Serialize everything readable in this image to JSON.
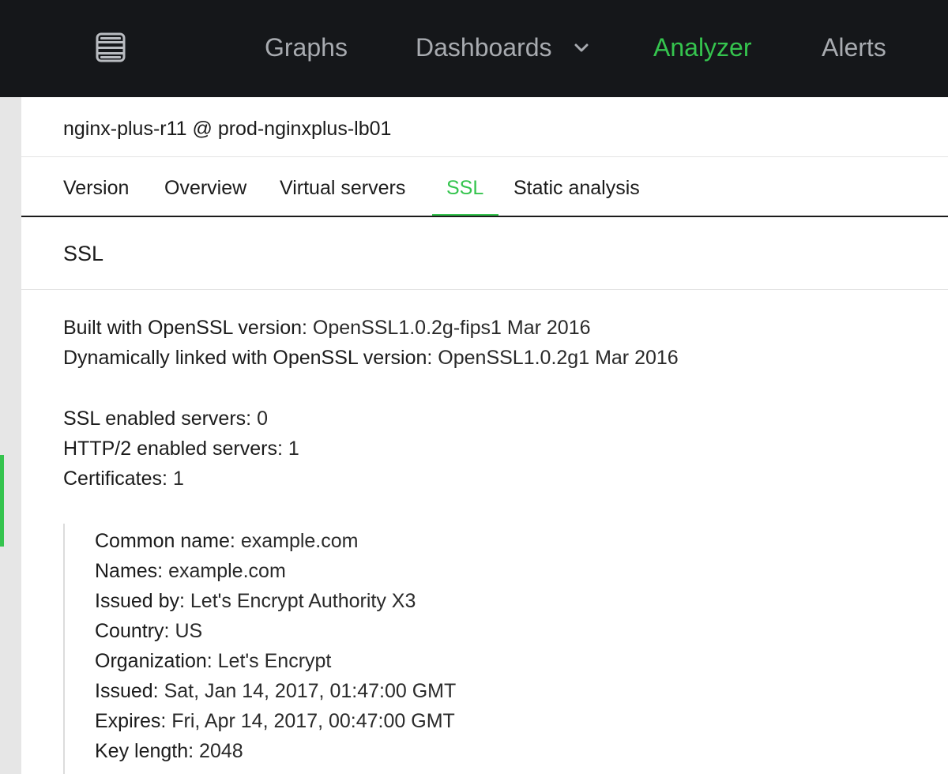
{
  "topnav": {
    "logo_icon": "server-stack-icon",
    "items": [
      {
        "label": "Graphs"
      },
      {
        "label": "Dashboards"
      },
      {
        "label": "Analyzer"
      },
      {
        "label": "Alerts"
      }
    ],
    "accent": "#35c44e"
  },
  "breadcrumb": "nginx-plus-r11 @ prod-nginxplus-lb01",
  "tabs": [
    {
      "label": "Version"
    },
    {
      "label": "Overview"
    },
    {
      "label": "Virtual servers"
    },
    {
      "label": "SSL"
    },
    {
      "label": "Static analysis"
    }
  ],
  "section": {
    "title": "SSL"
  },
  "openssl": {
    "built_label": "Built with OpenSSL version:",
    "built_value": "OpenSSL1.0.2g-fips1 Mar 2016",
    "linked_label": "Dynamically linked with OpenSSL version:",
    "linked_value": "OpenSSL1.0.2g1 Mar 2016"
  },
  "counts": {
    "ssl_label": "SSL enabled servers:",
    "ssl_value": "0",
    "http2_label": "HTTP/2 enabled servers:",
    "http2_value": "1",
    "certs_label": "Certificates:",
    "certs_value": "1"
  },
  "certificate": {
    "common_name_label": "Common name:",
    "common_name": "example.com",
    "names_label": "Names:",
    "names": "example.com",
    "issued_by_label": "Issued by:",
    "issued_by": "Let's Encrypt Authority X3",
    "country_label": "Country:",
    "country": "US",
    "organization_label": "Organization:",
    "organization": "Let's Encrypt",
    "issued_label": "Issued:",
    "issued": "Sat, Jan 14, 2017, 01:47:00 GMT",
    "expires_label": "Expires:",
    "expires": "Fri, Apr 14, 2017, 00:47:00 GMT",
    "key_length_label": "Key length:",
    "key_length": "2048"
  }
}
